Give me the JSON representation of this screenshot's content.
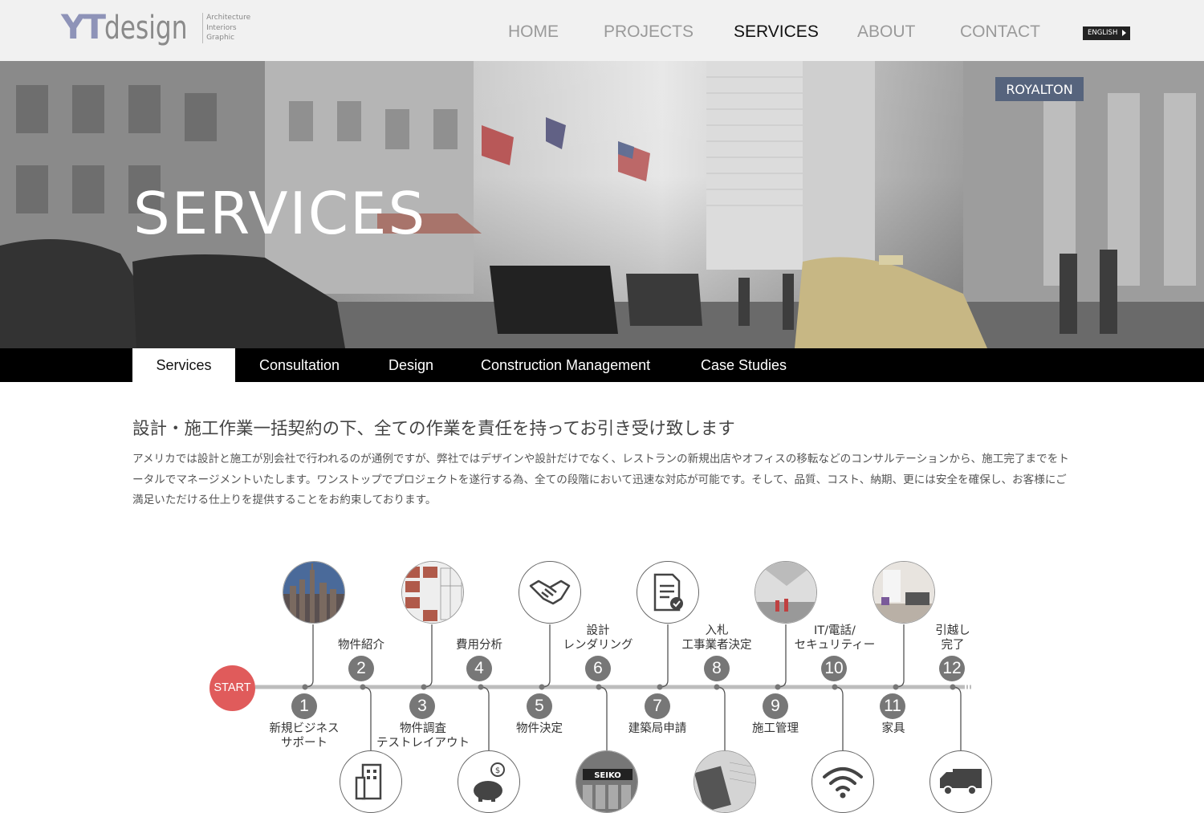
{
  "logo": {
    "mark": "YT",
    "word": "design",
    "tagline": [
      "Architecture",
      "Interiors",
      "Graphic"
    ]
  },
  "nav": {
    "items": [
      "HOME",
      "PROJECTS",
      "SERVICES",
      "ABOUT",
      "CONTACT"
    ],
    "active": "SERVICES",
    "language": "ENGLISH"
  },
  "hero": {
    "title": "SERVICES"
  },
  "subnav": {
    "tabs": [
      "Services",
      "Consultation",
      "Design",
      "Construction Management",
      "Case Studies"
    ],
    "active": "Services"
  },
  "intro": {
    "heading": "設計・施工作業一括契約の下、全ての作業を責任を持ってお引き受け致します",
    "paragraph": "アメリカでは設計と施工が別会社で行われるのが通例ですが、弊社ではデザインや設計だけでなく、レストランの新規出店やオフィスの移転などのコンサルテーションから、施工完了までをトータルでマネージメントいたします。ワンストップでプロジェクトを遂行する為、全ての段階において迅速な対応が可能です。そして、品質、コスト、納期、更には安全を確保し、お客様にご満足いただける仕上りを提供することをお約束しております。"
  },
  "timeline": {
    "start_label": "START",
    "steps": [
      {
        "number": "1",
        "label": [
          "新規ビジネス",
          "サポート"
        ],
        "icon": "city-skyline-photo"
      },
      {
        "number": "2",
        "label": [
          "物件紹介"
        ],
        "icon": "building-icon"
      },
      {
        "number": "3",
        "label": [
          "物件調査",
          "テストレイアウト"
        ],
        "icon": "floor-plan-photo"
      },
      {
        "number": "4",
        "label": [
          "費用分析"
        ],
        "icon": "piggy-bank-icon"
      },
      {
        "number": "5",
        "label": [
          "物件決定"
        ],
        "icon": "handshake-icon"
      },
      {
        "number": "6",
        "label": [
          "設計",
          "レンダリング"
        ],
        "icon": "storefront-photo"
      },
      {
        "number": "7",
        "label": [
          "建築局申請"
        ],
        "icon": "document-check-icon"
      },
      {
        "number": "8",
        "label": [
          "入札",
          "工事業者決定"
        ],
        "icon": "calculator-photo"
      },
      {
        "number": "9",
        "label": [
          "施工管理"
        ],
        "icon": "construction-site-photo"
      },
      {
        "number": "10",
        "label": [
          "IT/電話/",
          "セキュリティー"
        ],
        "icon": "wifi-icon"
      },
      {
        "number": "11",
        "label": [
          "家具"
        ],
        "icon": "furniture-photo"
      },
      {
        "number": "12",
        "label": [
          "引越し",
          "完了"
        ],
        "icon": "truck-icon"
      }
    ],
    "storefront_sign": "SEIKO"
  },
  "colors": {
    "accent_start": "#e05b5b",
    "step_circle": "#777777",
    "timeline_line": "#bdbdbd",
    "subnav_bg": "#000000"
  }
}
